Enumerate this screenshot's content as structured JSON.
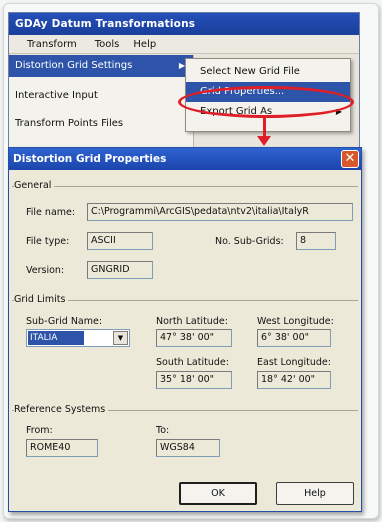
{
  "app": {
    "title": "GDAy Datum Transformations",
    "menubar": [
      "Transform",
      "Tools",
      "Help"
    ],
    "menu_items": [
      {
        "label": "Distortion Grid Settings",
        "has_submenu": true
      },
      {
        "label": "Interactive Input",
        "has_submenu": false
      },
      {
        "label": "Transform Points Files",
        "has_submenu": false
      }
    ],
    "submenu_items": [
      {
        "label": "Select New Grid File"
      },
      {
        "label": "Grid Properties..."
      },
      {
        "label": "Export Grid As",
        "has_submenu": true
      }
    ]
  },
  "dialog": {
    "title": "Distortion Grid Properties",
    "close_glyph": "✕",
    "general": {
      "title": "General",
      "file_name_label": "File name:",
      "file_name": "C:\\Programmi\\ArcGIS\\pedata\\ntv2\\italia\\ItalyR",
      "file_type_label": "File type:",
      "file_type": "ASCII",
      "num_subgrids_label": "No. Sub-Grids:",
      "num_subgrids": "8",
      "version_label": "Version:",
      "version": "GNGRID"
    },
    "grid_limits": {
      "title": "Grid Limits",
      "subgrid_name_label": "Sub-Grid Name:",
      "subgrid_name": "ITALIA",
      "north_lat_label": "North Latitude:",
      "north_lat": "47° 38' 00\"",
      "west_long_label": "West Longitude:",
      "west_long": "6° 38' 00\"",
      "south_lat_label": "South Latitude:",
      "south_lat": "35° 18' 00\"",
      "east_long_label": "East Longitude:",
      "east_long": "18° 42' 00\""
    },
    "reference_systems": {
      "title": "Reference Systems",
      "from_label": "From:",
      "from": "ROME40",
      "to_label": "To:",
      "to": "WGS84"
    },
    "ok_label": "OK",
    "help_label": "Help"
  },
  "colors": {
    "title_bar": "#1f47a8",
    "highlight_annotation": "#e01e28",
    "selection": "#2d54a8",
    "dialog_face": "#ece9d8"
  }
}
